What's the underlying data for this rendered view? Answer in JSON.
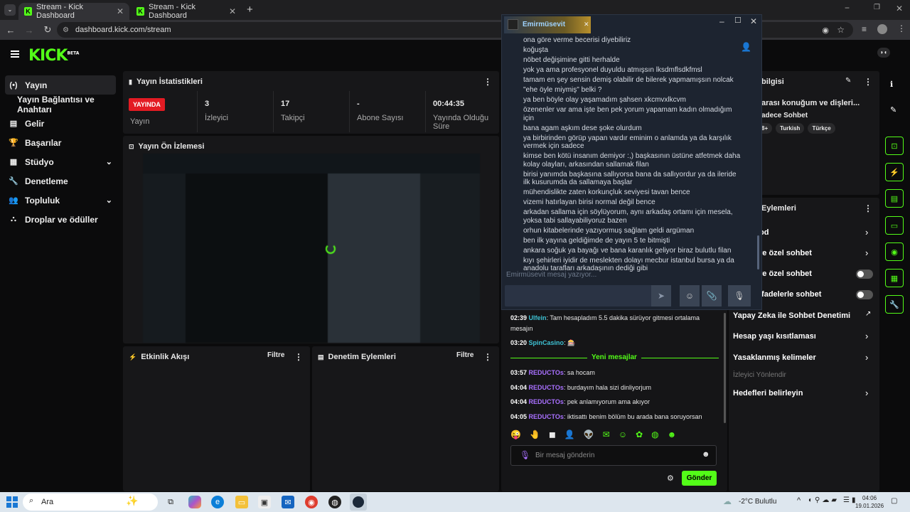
{
  "browser": {
    "tabs": [
      {
        "label": "Stream - Kick Dashboard"
      },
      {
        "label": "Stream - Kick Dashboard"
      }
    ],
    "url": "dashboard.kick.com/stream"
  },
  "header": {
    "logo": "KICK",
    "logo_badge": "BETA"
  },
  "sidebar": {
    "items": [
      {
        "label": "Yayın",
        "icon": "broadcast-icon"
      },
      {
        "label": "Yayın Bağlantısı ve Anahtarı"
      },
      {
        "label": "Gelir",
        "icon": "revenue-icon"
      },
      {
        "label": "Başarılar",
        "icon": "trophy-icon"
      },
      {
        "label": "Stüdyo",
        "icon": "studio-icon"
      },
      {
        "label": "Denetleme",
        "icon": "wrench-icon"
      },
      {
        "label": "Topluluk",
        "icon": "community-icon"
      },
      {
        "label": "Droplar ve ödüller",
        "icon": "drops-icon"
      }
    ]
  },
  "stats": {
    "title": "Yayın İstatistikleri",
    "live": "YAYINDA",
    "items": [
      {
        "value": "",
        "label": "Yayın"
      },
      {
        "value": "3",
        "label": "İzleyici"
      },
      {
        "value": "17",
        "label": "Takipçi"
      },
      {
        "value": "-",
        "label": "Abone Sayısı"
      },
      {
        "value": "00:44:35",
        "label": "Yayında Olduğu Süre"
      }
    ]
  },
  "preview": {
    "title": "Yayın Ön İzlemesi"
  },
  "activity": {
    "title": "Etkinlik Akışı",
    "filter": "Filtre"
  },
  "modlog": {
    "title": "Denetim Eylemleri",
    "filter": "Filtre"
  },
  "popup": {
    "username": "Emirmüsevit",
    "placeholder": "Emirmüsevit mesaj yazıyor...",
    "messages": [
      "ona göre verme becerisi diyebiliriz",
      "koğuşta",
      "nöbet değişimine gitti herhalde",
      "yok ya ama profesyonel duyuldu atmışsın lksdmflsdkfmsl",
      "tamam en şey sensin demiş olabilir de bilerek yapmamışsın nolcak",
      "\"ehe öyle miymiş\" belki ?",
      "ya ben böyle olay yaşamadım şahsen xkcmvxlkcvm",
      "özenenler var ama işte ben pek yorum yapamam kadın olmadığım için",
      "bana agam aşkım dese şoke olurdum",
      "ya birbirinden görüp yapan vardır eminim o anlamda ya da karşılık vermek için sadece",
      "kimse ben kötü insanım demiyor :,) başkasının üstüne atfetmek daha kolay olayları, arkasından sallamak filan",
      "birisi yanımda başkasına sallıyorsa bana da sallıyordur ya da ileride ilk kusurumda da sallamaya başlar",
      "mühendislikte zaten korkunçluk seviyesi tavan bence",
      "vizemi hatırlayan birisi normal değil bence",
      "arkadan sallama için söylüyorum, aynı arkadaş ortamı için mesela, yoksa tabi sallayabiliyoruz bazen",
      "orhun kitabelerinde yazıyormuş sağlam geldi argüman",
      "ben ilk yayına geldiğimde de yayın 5 te bitmişti",
      "ankara soğuk ya bayağı ve bana karanlık geliyor biraz bulutlu filan",
      "kıyı şehirleri iyidir de meslekten dolayı mecbur istanbul bursa ya da anadolu tarafları arkadaşının dediği gibi"
    ]
  },
  "chat": {
    "messages": [
      {
        "time": "02:39",
        "user": "Ulfein",
        "text": "Tam hesapladım 5.5 dakika sürüyor gitmesi ortalama mesajın",
        "color": "teal"
      },
      {
        "time": "03:20",
        "user": "SpinCasino",
        "text": "",
        "color": "teal"
      }
    ],
    "new_divider": "Yeni mesajlar",
    "new_messages": [
      {
        "time": "03:57",
        "user": "REDUCTOs",
        "text": "sa hocam"
      },
      {
        "time": "04:04",
        "user": "REDUCTOs",
        "text": "burdayım hala sizi dinliyorjum"
      },
      {
        "time": "04:04",
        "user": "REDUCTOs",
        "text": "pek anlamıyorum ama akıyor"
      },
      {
        "time": "04:05",
        "user": "REDUCTOs",
        "text": "iktisattı benim bölüm bu arada bana soruyorsan"
      }
    ],
    "input_placeholder": "Bir mesaj gönderin",
    "send_label": "Gönder"
  },
  "info": {
    "title_partial": "bilgisi",
    "stream_title_partial": "arası konuğum ve dişleri...",
    "category_partial": "adece Sohbet",
    "tags": [
      "8+",
      "Turkish",
      "Türkçe"
    ],
    "actions_title": "Eylemleri",
    "rows": [
      {
        "label": "od",
        "control": "chevron"
      },
      {
        "label": "re özel sohbet",
        "control": "chevron"
      },
      {
        "label": "re özel sohbet",
        "control": "toggle"
      },
      {
        "label": "ifadelerle sohbet",
        "control": "toggle"
      },
      {
        "label": "Yapay Zeka ile Sohbet Denetimi",
        "control": "external"
      },
      {
        "label": "Hesap yaşı kısıtlaması",
        "control": "chevron"
      },
      {
        "label": "Yasaklanmış kelimeler",
        "control": "chevron"
      },
      {
        "label": "İzleyici Yönlendir",
        "control": "none"
      },
      {
        "label": "Hedefleri belirleyin",
        "control": "chevron"
      }
    ]
  },
  "taskbar": {
    "search": "Ara",
    "weather": "-2°C Bulutlu",
    "time": "04:06",
    "date": "19.01.2026"
  },
  "colors": {
    "accent": "#53fc18",
    "live": "#e31b23",
    "purple": "#a970ff",
    "teal": "#3ec1d3"
  }
}
